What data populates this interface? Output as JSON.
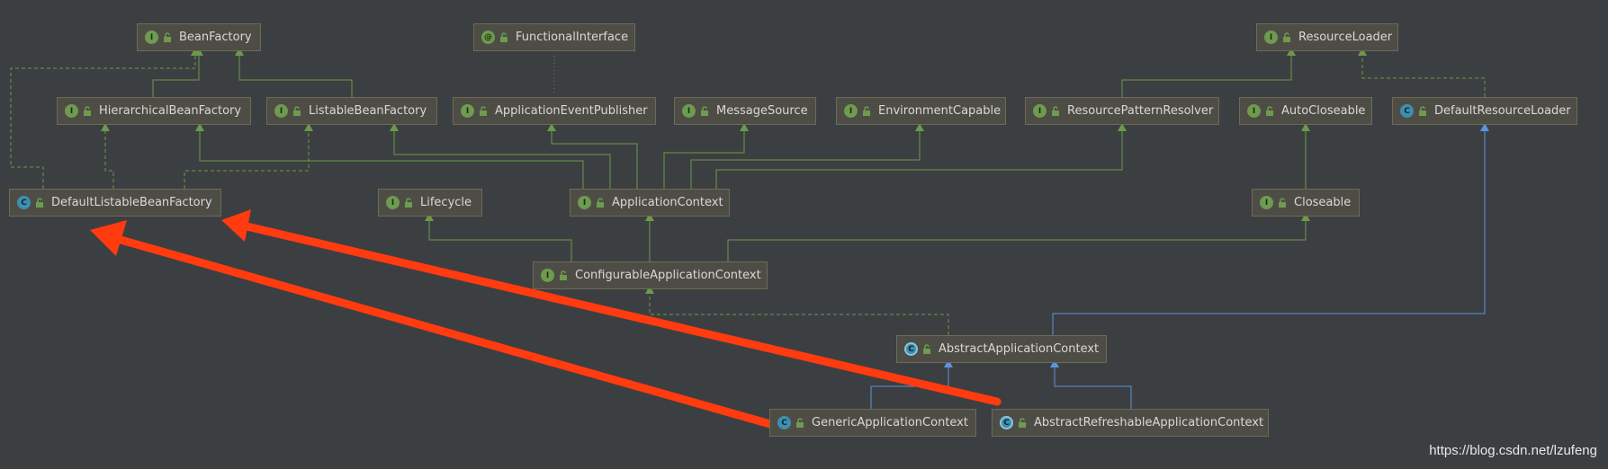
{
  "nodes": {
    "bean_factory": {
      "label": "BeanFactory",
      "kind": "I"
    },
    "functional_interface": {
      "label": "FunctionalInterface",
      "kind": "@"
    },
    "resource_loader": {
      "label": "ResourceLoader",
      "kind": "I"
    },
    "hierarchical_bean_factory": {
      "label": "HierarchicalBeanFactory",
      "kind": "I"
    },
    "listable_bean_factory": {
      "label": "ListableBeanFactory",
      "kind": "I"
    },
    "application_event_publisher": {
      "label": "ApplicationEventPublisher",
      "kind": "I"
    },
    "message_source": {
      "label": "MessageSource",
      "kind": "I"
    },
    "environment_capable": {
      "label": "EnvironmentCapable",
      "kind": "I"
    },
    "resource_pattern_resolver": {
      "label": "ResourcePatternResolver",
      "kind": "I"
    },
    "auto_closeable": {
      "label": "AutoCloseable",
      "kind": "I"
    },
    "default_resource_loader": {
      "label": "DefaultResourceLoader",
      "kind": "C"
    },
    "default_listable_bean_factory": {
      "label": "DefaultListableBeanFactory",
      "kind": "C"
    },
    "lifecycle": {
      "label": "Lifecycle",
      "kind": "I"
    },
    "application_context": {
      "label": "ApplicationContext",
      "kind": "I"
    },
    "closeable": {
      "label": "Closeable",
      "kind": "I"
    },
    "configurable_application_context": {
      "label": "ConfigurableApplicationContext",
      "kind": "I"
    },
    "abstract_application_context": {
      "label": "AbstractApplicationContext",
      "kind": "C"
    },
    "generic_application_context": {
      "label": "GenericApplicationContext",
      "kind": "C"
    },
    "abstract_refreshable_application_context": {
      "label": "AbstractRefreshableApplicationContext",
      "kind": "C"
    }
  },
  "watermark": "https://blog.csdn.net/lzufeng",
  "colors": {
    "background": "#3c3f41",
    "interface_badge": "#6e9b4f",
    "class_badge": "#3f8fb0",
    "interface_edge": "#6a9a4a",
    "class_edge": "#5b93e0",
    "annotation_edge": "#7a7a5e",
    "highlight_arrow": "#ff3b0f"
  }
}
